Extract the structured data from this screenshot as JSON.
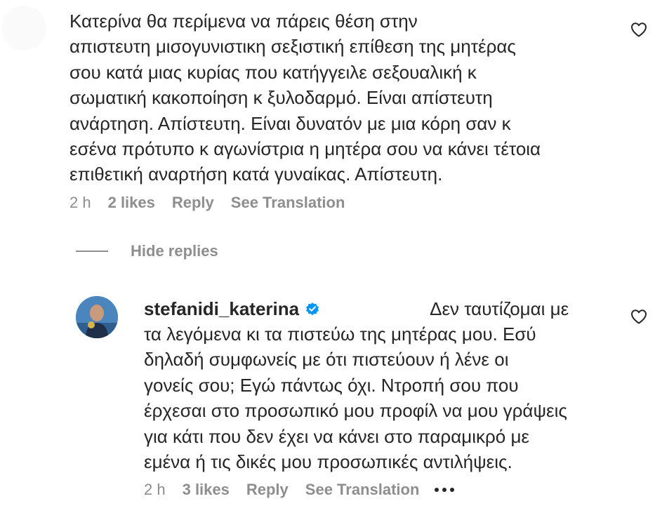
{
  "comment_1": {
    "text": "Κατερίνα θα περίμενα να πάρεις θέση στην\nαπιστευτη μισογυνιστικη σεξιστική επίθεση της μητέρας\nσου κατά μιας κυρίας που κατήγγειλε σεξουαλική κ\nσωματική κακοποίηση κ ξυλοδαρμό. Είναι απίστευτη\nανάρτηση. Απίστευτη. Είναι δυνατόν με μια κόρη σαν κ\nεσένα πρότυπο κ αγωνίστρια η μητέρα σου να κάνει τέτοια\nεπιθετική αναρτήση κατά γυναίκας. Απίστευτη.",
    "time": "2 h",
    "likes": "2 likes",
    "reply": "Reply",
    "see_translation": "See Translation"
  },
  "hide_replies": "Hide replies",
  "comment_2": {
    "username": "stefanidi_katerina",
    "first_line": "Δεν ταυτίζομαι με",
    "text": "τα λεγόμενα κι τα πιστεύω της μητέρας μου. Εσύ\nδηλαδή συμφωνείς με ότι πιστεύουν ή λένε οι\nγονείς σου; Εγώ πάντως όχι. Ντροπή σου που\nέρχεσαι στο προσωπικό μου προφίλ να μου γράψεις\nγια κάτι που δεν έχει να κάνει στο παραμικρό με\nεμένα ή τις δικές μου προσωπικές αντιλήψεις.",
    "time": "2 h",
    "likes": "3 likes",
    "reply": "Reply",
    "see_translation": "See Translation"
  },
  "icons": {
    "like": "heart-outline-icon",
    "verified": "verified-badge-icon",
    "more": "more-options-icon"
  },
  "colors": {
    "text": "#262626",
    "secondary": "#8e8e8e",
    "verified": "#0095f6"
  }
}
